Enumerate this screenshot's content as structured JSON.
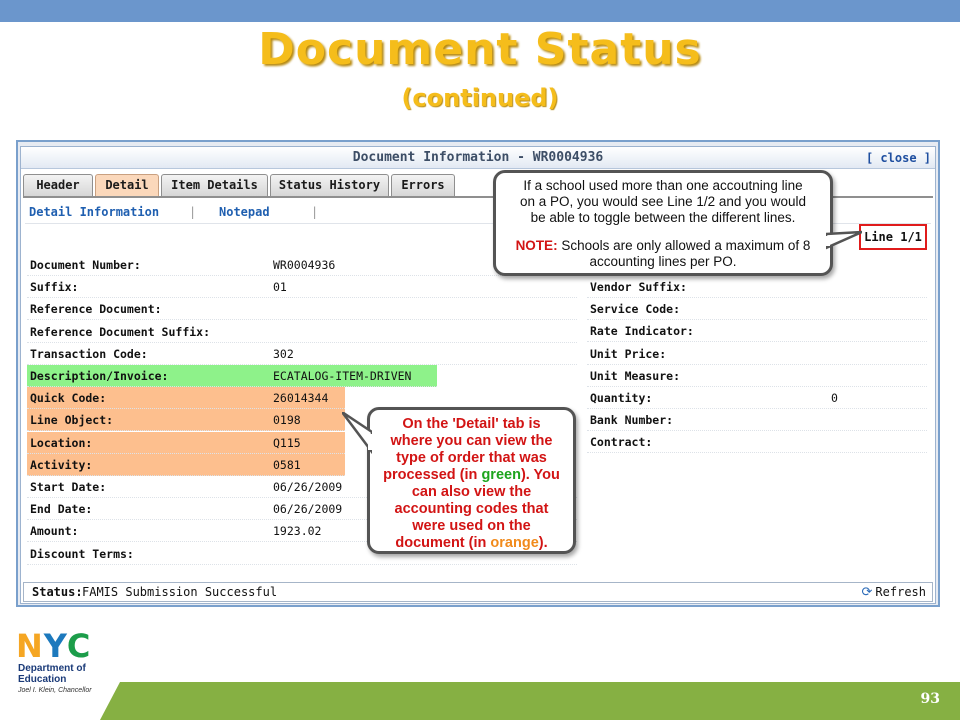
{
  "slide": {
    "title": "Document Status",
    "subtitle": "(continued)",
    "page_number": "93"
  },
  "window": {
    "title": "Document Information - WR0004936",
    "close_label": "[ close ]"
  },
  "tabs": [
    {
      "label": "Header",
      "active": false
    },
    {
      "label": "Detail",
      "active": true
    },
    {
      "label": "Item Details",
      "active": false
    },
    {
      "label": "Status History",
      "active": false
    },
    {
      "label": "Errors",
      "active": false
    }
  ],
  "subnav": [
    {
      "label": "Detail Information"
    },
    {
      "label": "Notepad"
    }
  ],
  "line_indicator": "Line 1/1",
  "left_fields": [
    {
      "label": "Document Number:",
      "value": "WR0004936",
      "highlight": ""
    },
    {
      "label": "Suffix:",
      "value": "01",
      "highlight": ""
    },
    {
      "label": "Reference Document:",
      "value": "",
      "highlight": ""
    },
    {
      "label": "Reference Document Suffix:",
      "value": "",
      "highlight": ""
    },
    {
      "label": "Transaction Code:",
      "value": "302",
      "highlight": ""
    },
    {
      "label": "Description/Invoice:",
      "value": "ECATALOG-ITEM-DRIVEN",
      "highlight": "green"
    },
    {
      "label": "Quick Code:",
      "value": "26014344",
      "highlight": "orange"
    },
    {
      "label": "Line Object:",
      "value": "0198",
      "highlight": "orange"
    },
    {
      "label": "Location:",
      "value": "Q115",
      "highlight": "orange"
    },
    {
      "label": "Activity:",
      "value": "0581",
      "highlight": "orange"
    },
    {
      "label": "Start Date:",
      "value": "06/26/2009",
      "highlight": ""
    },
    {
      "label": "End Date:",
      "value": "06/26/2009",
      "highlight": ""
    },
    {
      "label": "Amount:",
      "value": "1923.02",
      "highlight": ""
    },
    {
      "label": "Discount Terms:",
      "value": "",
      "highlight": ""
    }
  ],
  "right_fields": [
    {
      "label": "Vendor Suffix:",
      "value": ""
    },
    {
      "label": "Service Code:",
      "value": ""
    },
    {
      "label": "Rate Indicator:",
      "value": ""
    },
    {
      "label": "Unit Price:",
      "value": ""
    },
    {
      "label": "Unit Measure:",
      "value": ""
    },
    {
      "label": "Quantity:",
      "value": "0"
    },
    {
      "label": "Bank Number:",
      "value": ""
    },
    {
      "label": "Contract:",
      "value": ""
    }
  ],
  "status": {
    "label": "Status:",
    "text": "FAMIS Submission Successful",
    "refresh_label": "Refresh",
    "refresh_icon": "refresh-icon"
  },
  "callout_lines": {
    "line_1": {
      "text_lines": [
        "If a school used more than one accoutning line",
        "on a PO, you would see Line 1/2 and you would",
        "be able to toggle between the different lines."
      ],
      "note_label": "NOTE:",
      "note_text_1": " Schools are only allowed a maximum of 8",
      "note_text_2": "accounting lines per PO."
    },
    "detail": {
      "l1": "On the 'Detail' tab is",
      "l2": "where you can view the",
      "l3": "type of order that was",
      "l4a": "processed (in ",
      "l4b": "green",
      "l4c": ").  You",
      "l5": "can also view the",
      "l6": "accounting codes that",
      "l7": "were used on the",
      "l8a": "document (in ",
      "l8b": "orange",
      "l8c": ")."
    }
  },
  "logo": {
    "letters_n": "N",
    "letters_y": "Y",
    "letters_c": "C",
    "dept_line1": "Department of",
    "dept_line2": "Education",
    "chancellor": "Joel I. Klein, Chancellor"
  },
  "colors": {
    "title": "#f5bd1b",
    "green_highlight": "#8ef28a",
    "orange_highlight": "#fdbf8e",
    "top_bar": "#6b96cc",
    "bottom_band": "#86b043"
  }
}
